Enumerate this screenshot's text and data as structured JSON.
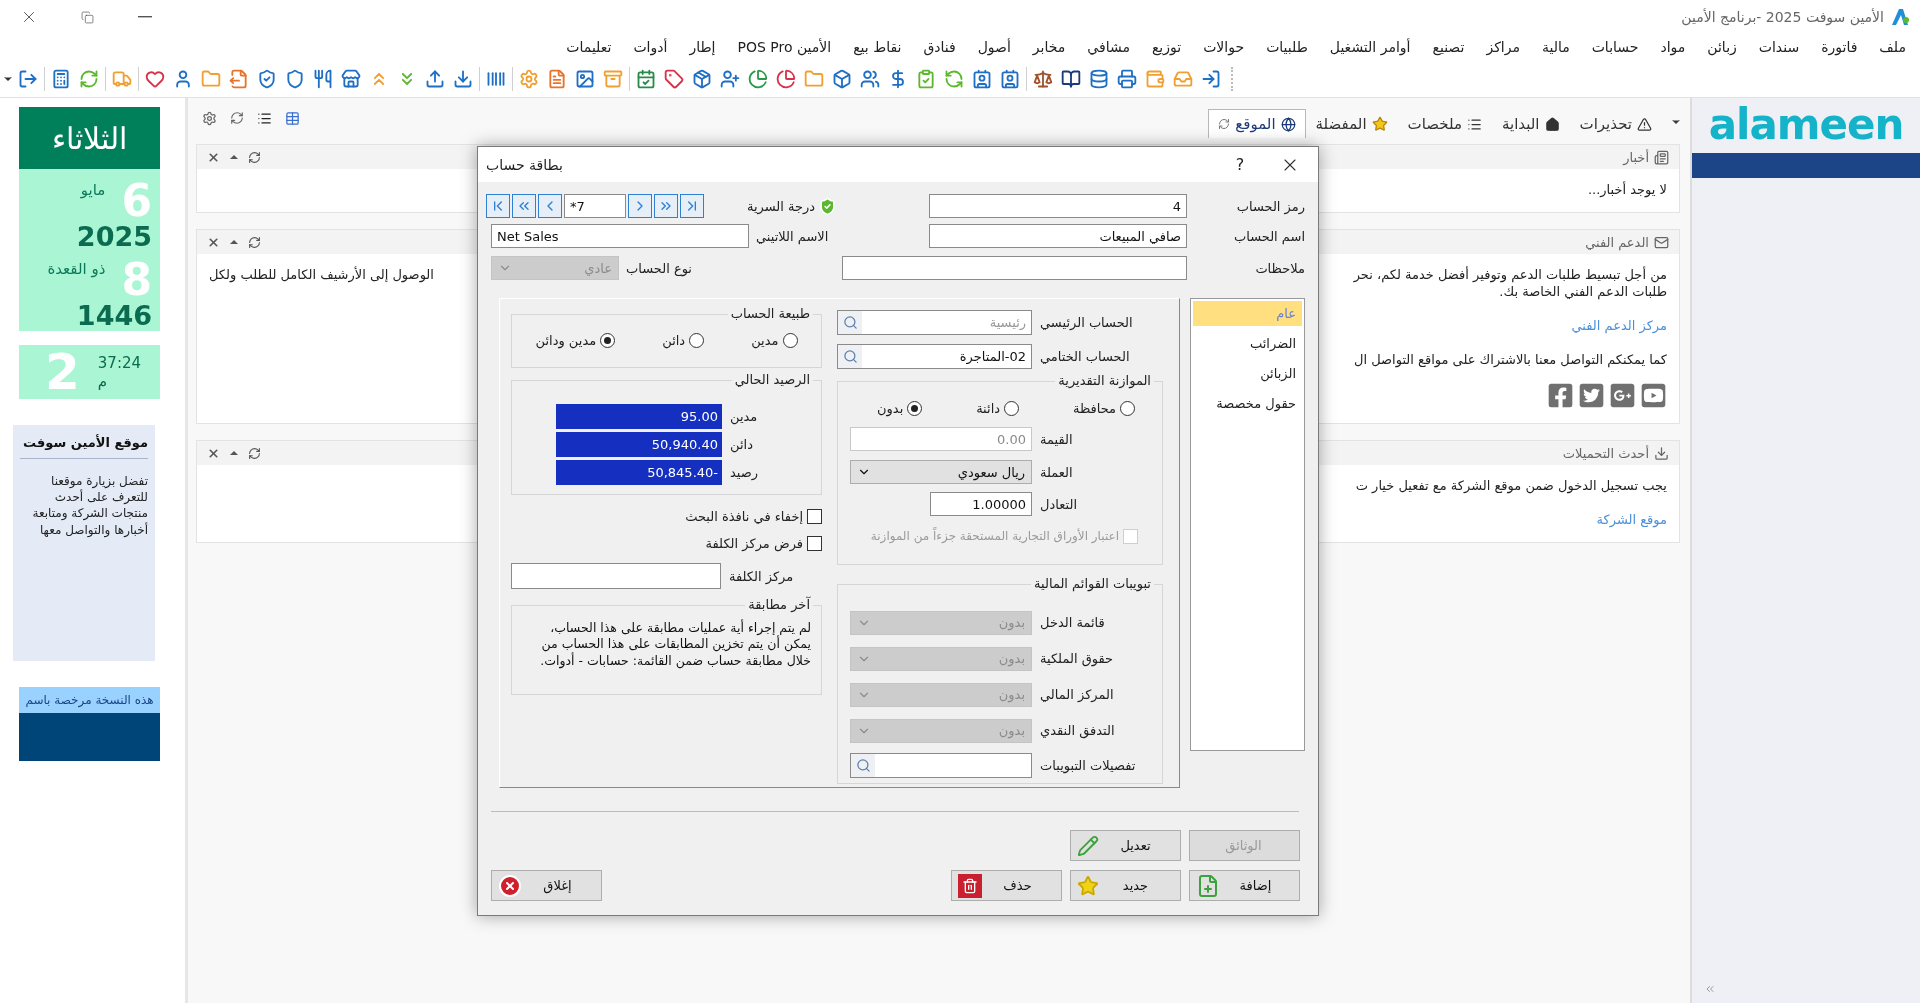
{
  "window": {
    "title": "الأمين سوفت 2025 -برنامج الأمين"
  },
  "menu": [
    "ملف",
    "فاتورة",
    "سندات",
    "زبائن",
    "مواد",
    "حسابات",
    "مالية",
    "مراكز",
    "تصنيع",
    "أوامر التشغيل",
    "طلبيات",
    "حوالات",
    "توزيع",
    "مشافي",
    "مخابر",
    "أصول",
    "فنادق",
    "نقاط بيع",
    "الأمين POS Pro",
    "إطار",
    "أدوات",
    "تعليمات"
  ],
  "calendar": {
    "weekday": "الثلاثاء",
    "day": "6",
    "month": "مايو",
    "year": "2025",
    "hijri_day": "8",
    "hijri_month": "ذو القعدة",
    "hijri_year": "1446"
  },
  "clock": {
    "hour": "2",
    "minutes": "37:24",
    "period": "م"
  },
  "site_box": {
    "title": "موقع الأمين سوفت",
    "text": "تفضل بزيارة موقعنا للتعرف على أحدث منتجات الشركة ومتابعة أخبارها والتواصل معها"
  },
  "license": {
    "text": "هذه النسخة مرخصة باسم"
  },
  "tabs": [
    {
      "label": "تحذيرات",
      "selected": false
    },
    {
      "label": "البداية",
      "selected": false
    },
    {
      "label": "ملخصات",
      "selected": false
    },
    {
      "label": "المفضلة",
      "selected": false
    },
    {
      "label": "الموقع",
      "selected": true
    }
  ],
  "panels": [
    {
      "title": "أخبار",
      "lines": [
        {
          "kind": "text",
          "text": "لا يوجد أخبار..."
        }
      ]
    },
    {
      "title": "الدعم الفني",
      "lines": [
        {
          "kind": "text",
          "text": "من أجل تبسيط طلبات الدعم وتوفير أفضل خدمة لكم، نحر",
          "left_text": "الوصول إلى الأرشيف الكامل للطلب ولكل"
        },
        {
          "kind": "text",
          "text": "طلبات الدعم الفني الخاصة بك."
        },
        {
          "kind": "link",
          "text": "مركز الدعم الفني"
        },
        {
          "kind": "text",
          "text": "كما يمكنكم التواصل معنا بالاشتراك على مواقع التواصل ال"
        },
        {
          "kind": "social"
        }
      ]
    },
    {
      "title": "أحدث التحميلات",
      "lines": [
        {
          "kind": "text",
          "text": "يجب تسجيل الدخول ضمن موقع الشركة مع تفعيل خيار ت"
        },
        {
          "kind": "link",
          "text": "موقع الشركة"
        }
      ]
    }
  ],
  "logo": {
    "text": "alameen"
  },
  "dialog": {
    "title": "بطاقة حساب",
    "help": "?",
    "record": "*7",
    "secrecy_label": "درجة السرية",
    "code": {
      "label": "رمز الحساب",
      "value": "4"
    },
    "name": {
      "label": "اسم الحساب",
      "value": "صافي المبيعات"
    },
    "latin_name": {
      "label": "الاسم اللاتيني",
      "value": "Net Sales"
    },
    "notes": {
      "label": "ملاحظات"
    },
    "account_type": {
      "label": "نوع الحساب",
      "value": "عادي",
      "disabled": true
    },
    "side_tabs": [
      {
        "label": "عام",
        "selected": true
      },
      {
        "label": "الضرائب",
        "selected": false
      },
      {
        "label": "الزبائن",
        "selected": false
      },
      {
        "label": "حقول مخصصة",
        "selected": false
      }
    ],
    "main_account": {
      "label": "الحساب الرئيسي",
      "placeholder": "رئيسية"
    },
    "final_account": {
      "label": "الحساب الختامي",
      "value": "02-المتاجرة"
    },
    "nature": {
      "title": "طبيعة الحساب",
      "options": [
        {
          "label": "مدين",
          "selected": false
        },
        {
          "label": "دائن",
          "selected": false
        },
        {
          "label": "مدين ودائن",
          "selected": true
        }
      ]
    },
    "balance": {
      "title": "الرصيد الحالي",
      "rows": [
        {
          "label": "مدين",
          "value": "95.00"
        },
        {
          "label": "دائن",
          "value": "50,940.40"
        },
        {
          "label": "رصيد",
          "value": "50,845.40-"
        }
      ]
    },
    "checks": [
      {
        "label": "إخفاء في نافذة البحث",
        "checked": false
      },
      {
        "label": "فرض مركز الكلفة",
        "checked": false
      }
    ],
    "cost_center": {
      "label": "مركز الكلفة"
    },
    "last_match": {
      "title": "آخر مطابقة",
      "text": "لم يتم إجراء أية عمليات مطابقة على هذا الحساب، يمكن أن يتم تخزين المطابقات على هذا الحساب من خلال مطابقة حساب ضمن القائمة: حسابات - أدوات."
    },
    "budget": {
      "title": "الموازنة التقديرية",
      "options": [
        {
          "label": "محافظة",
          "selected": false
        },
        {
          "label": "دائنة",
          "selected": false
        },
        {
          "label": "بدون",
          "selected": true
        }
      ],
      "amount": {
        "label": "القيمة",
        "value": "0.00",
        "disabled": true
      },
      "currency": {
        "label": "العملة",
        "value": "ريال سعودي"
      },
      "rate": {
        "label": "التعادل",
        "value": "1.00000"
      },
      "bills": {
        "label": "اعتبار الأوراق التجارية المستحقة جزءاً من الموازنة",
        "checked": false,
        "disabled": true
      }
    },
    "classifications": {
      "title": "تبويبات القوائم المالية",
      "selects": [
        {
          "label": "قائمة الدخل",
          "value": "بدون",
          "disabled": true
        },
        {
          "label": "حقوق الملكية",
          "value": "بدون",
          "disabled": true
        },
        {
          "label": "المركز المالي",
          "value": "بدون",
          "disabled": true
        },
        {
          "label": "التدفق النقدي",
          "value": "بدون",
          "disabled": true
        }
      ],
      "details": {
        "label": "تفصيلات التبويبات"
      }
    },
    "buttons_top": [
      {
        "label": "الوثائق",
        "kind": "documents",
        "disabled": true
      },
      {
        "label": "تعديل",
        "kind": "edit",
        "disabled": false
      }
    ],
    "buttons_bottom": [
      {
        "label": "إضافة",
        "kind": "add",
        "disabled": false
      },
      {
        "label": "جديد",
        "kind": "new",
        "disabled": false
      },
      {
        "label": "حذف",
        "kind": "delete",
        "disabled": false
      },
      {
        "label": "إغلاق",
        "kind": "close",
        "disabled": false
      }
    ]
  }
}
